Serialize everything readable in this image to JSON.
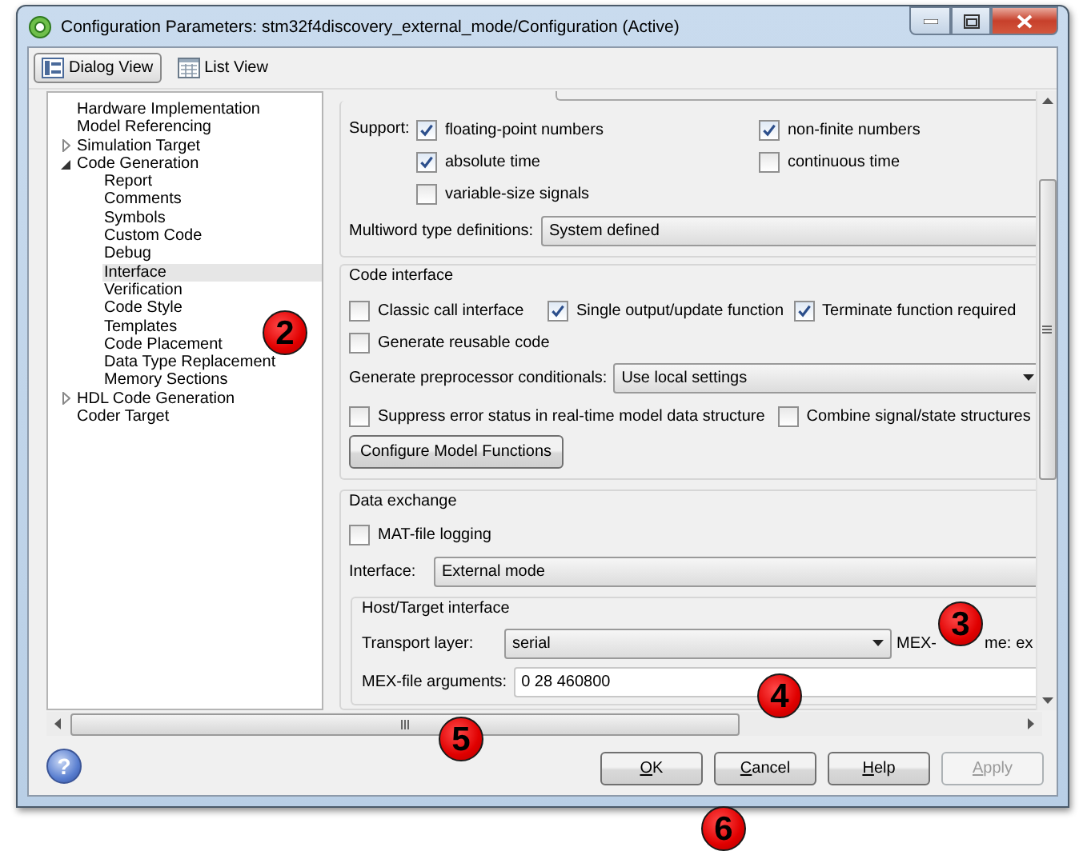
{
  "window": {
    "title": "Configuration Parameters: stm32f4discovery_external_mode/Configuration (Active)"
  },
  "view_tabs": [
    {
      "label": "Dialog View",
      "selected": true
    },
    {
      "label": "List View",
      "selected": false
    }
  ],
  "tree": {
    "items": [
      {
        "label": "Hardware Implementation",
        "selected": false
      },
      {
        "label": "Model Referencing",
        "selected": false
      },
      {
        "label": "Simulation Target",
        "selected": false,
        "expanded": false
      },
      {
        "label": "Code Generation",
        "selected": false,
        "expanded": true,
        "children": [
          {
            "label": "Report",
            "selected": false
          },
          {
            "label": "Comments",
            "selected": false
          },
          {
            "label": "Symbols",
            "selected": false
          },
          {
            "label": "Custom Code",
            "selected": false
          },
          {
            "label": "Debug",
            "selected": false
          },
          {
            "label": "Interface",
            "selected": true
          },
          {
            "label": "Verification",
            "selected": false
          },
          {
            "label": "Code Style",
            "selected": false
          },
          {
            "label": "Templates",
            "selected": false
          },
          {
            "label": "Code Placement",
            "selected": false
          },
          {
            "label": "Data Type Replacement",
            "selected": false
          },
          {
            "label": "Memory Sections",
            "selected": false
          }
        ]
      },
      {
        "label": "HDL Code Generation",
        "selected": false,
        "expanded": false
      },
      {
        "label": "Coder Target",
        "selected": false
      }
    ]
  },
  "support": {
    "label": "Support:",
    "options": [
      {
        "label": "floating-point numbers",
        "checked": true
      },
      {
        "label": "non-finite numbers",
        "checked": true
      },
      {
        "label": "absolute time",
        "checked": true
      },
      {
        "label": "continuous time",
        "checked": false
      },
      {
        "label": "variable-size signals",
        "checked": false
      }
    ]
  },
  "multiword": {
    "label": "Multiword type definitions:",
    "value": "System defined"
  },
  "code_interface": {
    "title": "Code interface",
    "row_1": [
      {
        "label": "Classic call interface",
        "checked": false
      },
      {
        "label": "Single output/update function",
        "checked": true
      },
      {
        "label": "Terminate function required",
        "checked": true
      }
    ],
    "row_2": [
      {
        "label": "Generate reusable code",
        "checked": false
      }
    ],
    "preprocessor": {
      "label": "Generate preprocessor conditionals:",
      "value": "Use local settings"
    },
    "row_3": [
      {
        "label": "Suppress error status in real-time model data structure",
        "checked": false
      },
      {
        "label": "Combine signal/state structures",
        "checked": false
      }
    ],
    "button": "Configure Model Functions"
  },
  "data_exchange": {
    "title": "Data exchange",
    "mat_logging": {
      "label": "MAT-file logging",
      "checked": false
    },
    "interface": {
      "label": "Interface:",
      "value": "External mode"
    },
    "host_target": {
      "title": "Host/Target interface",
      "transport": {
        "label": "Transport layer:",
        "value": "serial"
      },
      "mex_name": {
        "label_start": "MEX-",
        "label_end": "me:",
        "value": "ex"
      },
      "mex_args": {
        "label": "MEX-file arguments:",
        "value": "0 28 460800"
      }
    }
  },
  "help": "?",
  "buttons": [
    {
      "label": "OK",
      "disabled": false
    },
    {
      "label": "Cancel",
      "disabled": false
    },
    {
      "label": "Help",
      "disabled": false
    },
    {
      "label": "Apply",
      "disabled": true
    }
  ],
  "callouts": [
    {
      "number": "2"
    },
    {
      "number": "3"
    },
    {
      "number": "4"
    },
    {
      "number": "5"
    },
    {
      "number": "6"
    }
  ]
}
